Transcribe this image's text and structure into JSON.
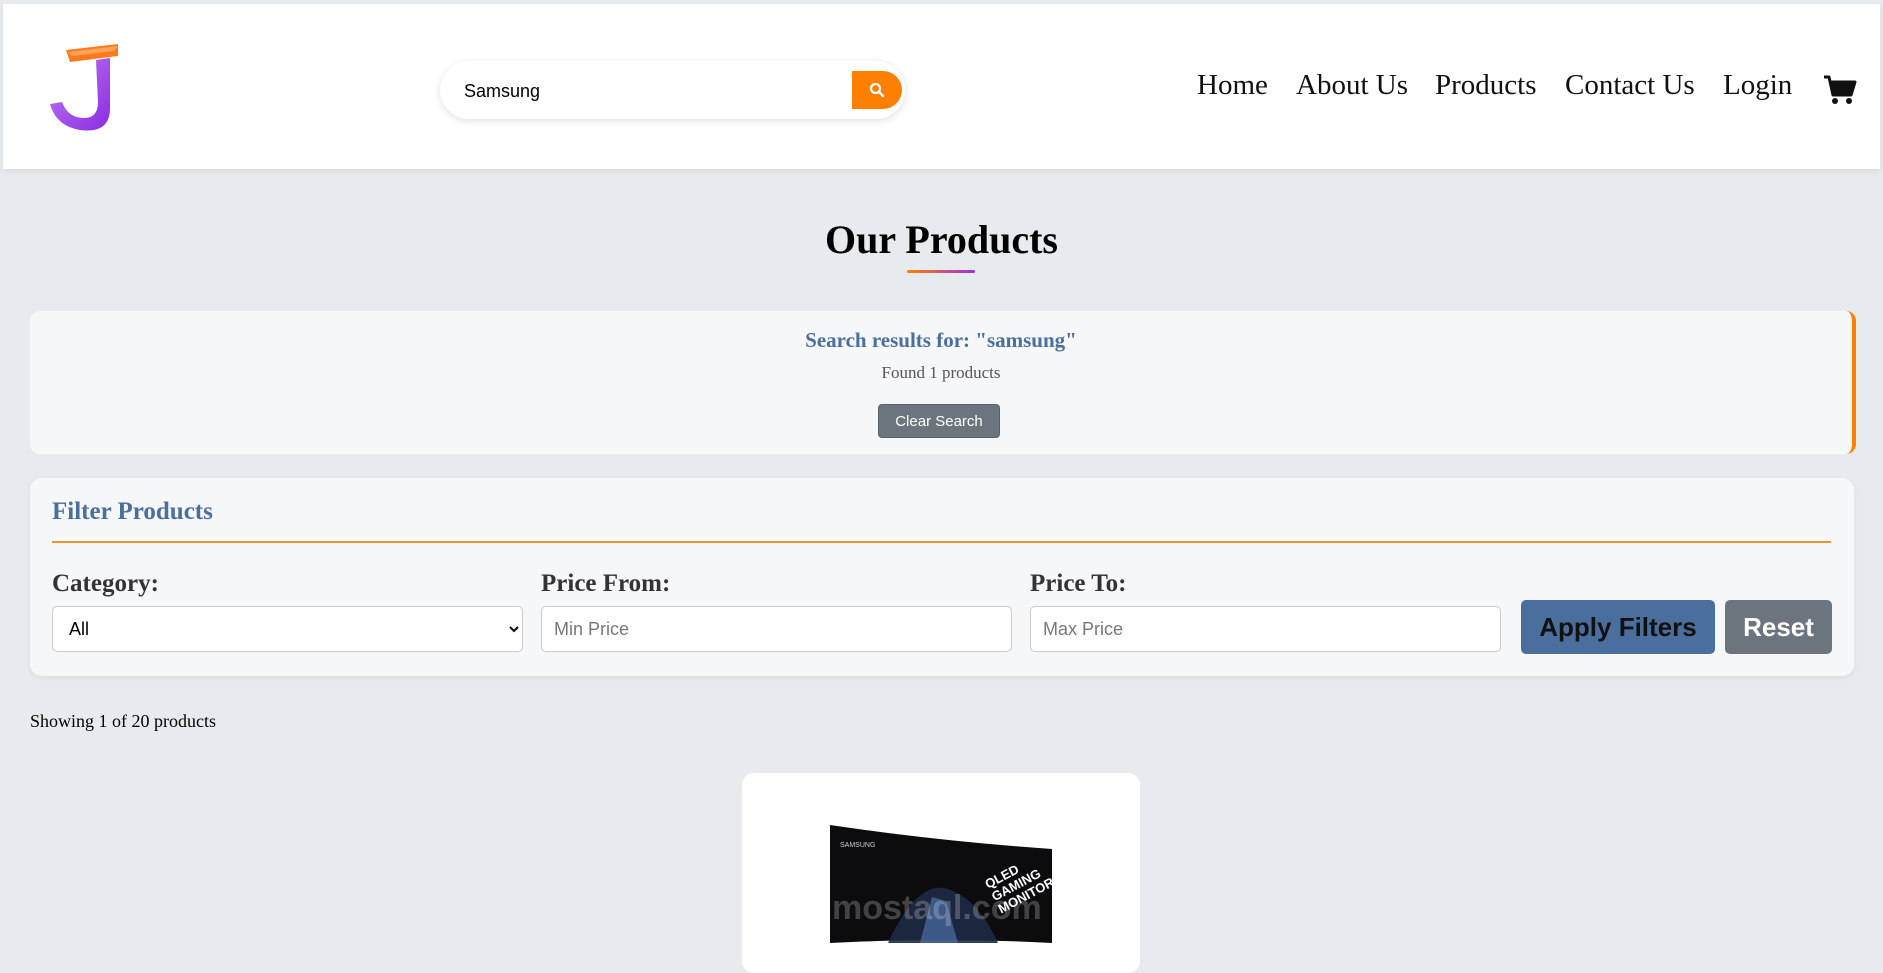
{
  "header": {
    "logo_icon": "stylized-j-logo",
    "search": {
      "value": "Samsung",
      "placeholder": "",
      "icon": "search-icon"
    },
    "nav": [
      {
        "label": "Home"
      },
      {
        "label": "About Us"
      },
      {
        "label": "Products"
      },
      {
        "label": "Contact Us"
      },
      {
        "label": "Login"
      }
    ],
    "cart_icon": "shopping-cart-icon"
  },
  "page": {
    "title": "Our Products"
  },
  "search_results": {
    "title": "Search results for: \"samsung\"",
    "count_text": "Found 1 products",
    "clear_label": "Clear Search"
  },
  "filter": {
    "title": "Filter Products",
    "category_label": "Category:",
    "category_selected": "All",
    "price_from_label": "Price From:",
    "price_from_placeholder": "Min Price",
    "price_to_label": "Price To:",
    "price_to_placeholder": "Max Price",
    "apply_label": "Apply Filters",
    "reset_label": "Reset"
  },
  "listing": {
    "showing_text": "Showing 1 of 20 products"
  },
  "product": {
    "image_text": "QLED GAMING MONITOR",
    "brand_text": "SAMSUNG",
    "watermark": "mostaql.com"
  },
  "colors": {
    "accent": "#ff7f00",
    "primary": "#4a6f9e",
    "secondary": "#6c757d",
    "background": "#e8ebee"
  }
}
